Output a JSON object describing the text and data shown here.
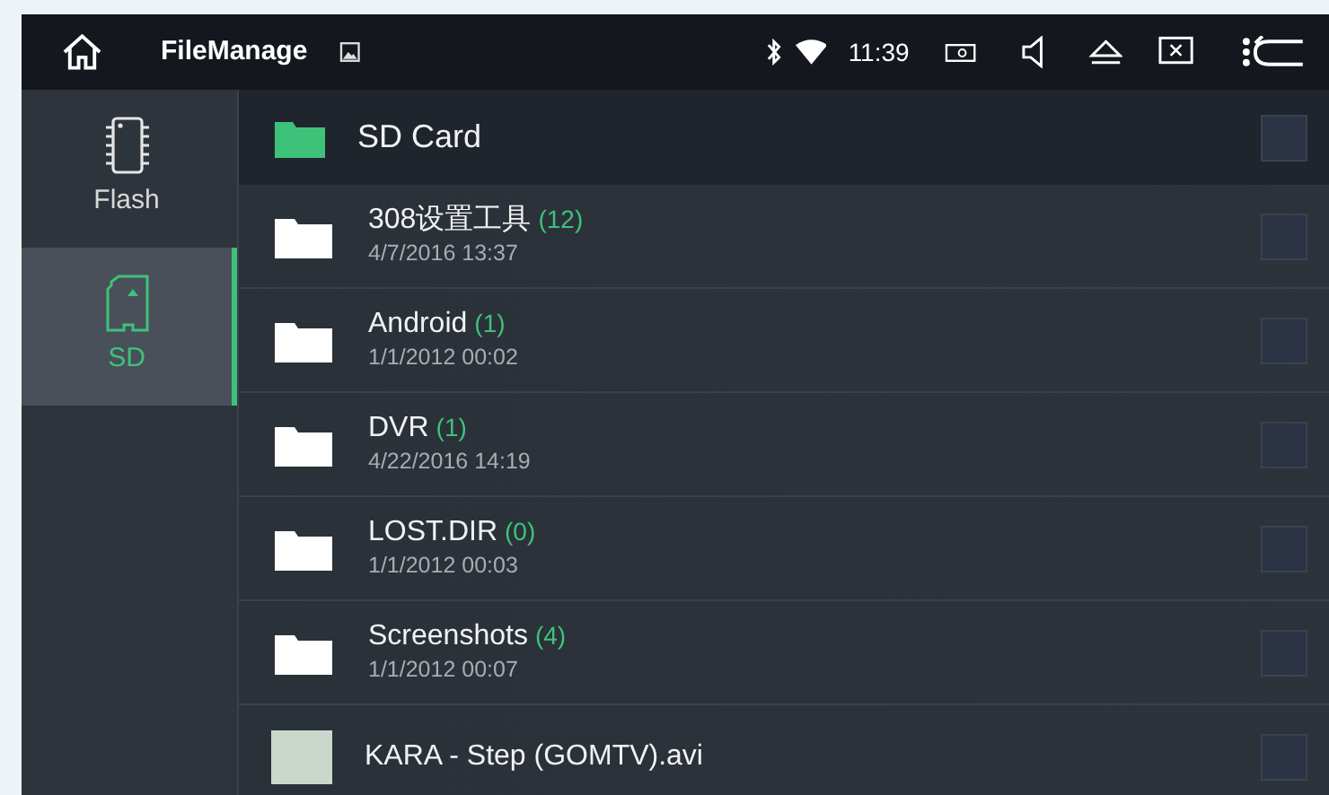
{
  "top_bar": {
    "title": "FileManage",
    "time": "11:39"
  },
  "sidebar": {
    "items": [
      {
        "label": "Flash",
        "kind": "flash",
        "selected": false
      },
      {
        "label": "SD",
        "kind": "sd",
        "selected": true
      }
    ]
  },
  "location": {
    "name": "SD Card",
    "checked": false
  },
  "entries": [
    {
      "kind": "folder",
      "name": "308设置工具",
      "count": "(12)",
      "date": "4/7/2016 13:37",
      "checked": false
    },
    {
      "kind": "folder",
      "name": "Android",
      "count": "(1)",
      "date": "1/1/2012 00:02",
      "checked": false
    },
    {
      "kind": "folder",
      "name": "DVR",
      "count": "(1)",
      "date": "4/22/2016 14:19",
      "checked": false
    },
    {
      "kind": "folder",
      "name": "LOST.DIR",
      "count": "(0)",
      "date": "1/1/2012 00:03",
      "checked": false
    },
    {
      "kind": "folder",
      "name": "Screenshots",
      "count": "(4)",
      "date": "1/1/2012 00:07",
      "checked": false
    },
    {
      "kind": "video",
      "name": "KARA - Step (GOMTV).avi",
      "checked": false
    }
  ]
}
